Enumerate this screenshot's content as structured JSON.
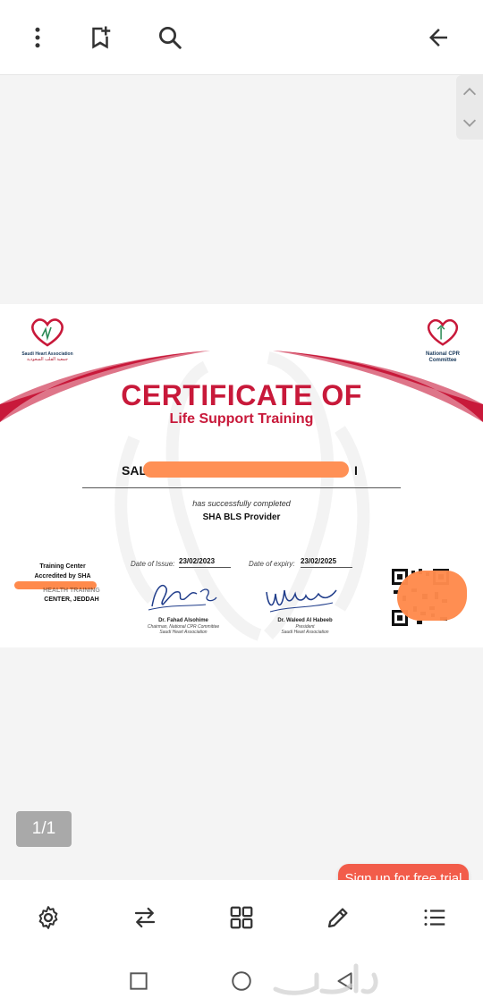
{
  "toolbar": {
    "icons": [
      "more-vert-icon",
      "bookmark-add-icon",
      "search-icon",
      "back-arrow-icon"
    ]
  },
  "certificate": {
    "title": "CERTIFICATE OF",
    "subtitle": "Life Support Training",
    "recipient_visible_start": "SAL",
    "recipient_visible_end": "I",
    "completed_text": "has successfully completed",
    "course": "SHA BLS Provider",
    "left_logo_caption": "Saudi Heart Association",
    "left_logo_caption_ar": "جمعية القلب السعودية",
    "right_logo_caption_1": "National CPR",
    "right_logo_caption_2": "Committee",
    "training_center_label": "Training Center",
    "accredited_label": "Accredited by SHA",
    "training_center_name_partial": "HEALTH TRAINING",
    "training_center_city": "CENTER, JEDDAH",
    "issue_label": "Date of Issue:",
    "issue_date": "23/02/2023",
    "expiry_label": "Date of expiry:",
    "expiry_date": "23/02/2025",
    "signer1_name": "Dr. Fahad Alsohime",
    "signer1_role1": "Chairman, National CPR Committee",
    "signer1_role2": "Saudi Heart Association",
    "signer2_name": "Dr. Waleed Al Habeeb",
    "signer2_role1": "President",
    "signer2_role2": "Saudi Heart Association",
    "brand_red": "#c8193a"
  },
  "viewer": {
    "page_counter": "1/1",
    "signup_label": "Sign up for free trial",
    "signup_color": "#f25c4a"
  },
  "bottom_toolbar": {
    "icons": [
      "settings-icon",
      "swap-icon",
      "grid-icon",
      "edit-icon",
      "list-icon"
    ]
  },
  "system_nav": {
    "icons": [
      "recents-icon",
      "home-icon",
      "back-icon"
    ]
  },
  "watermark": "حراج"
}
